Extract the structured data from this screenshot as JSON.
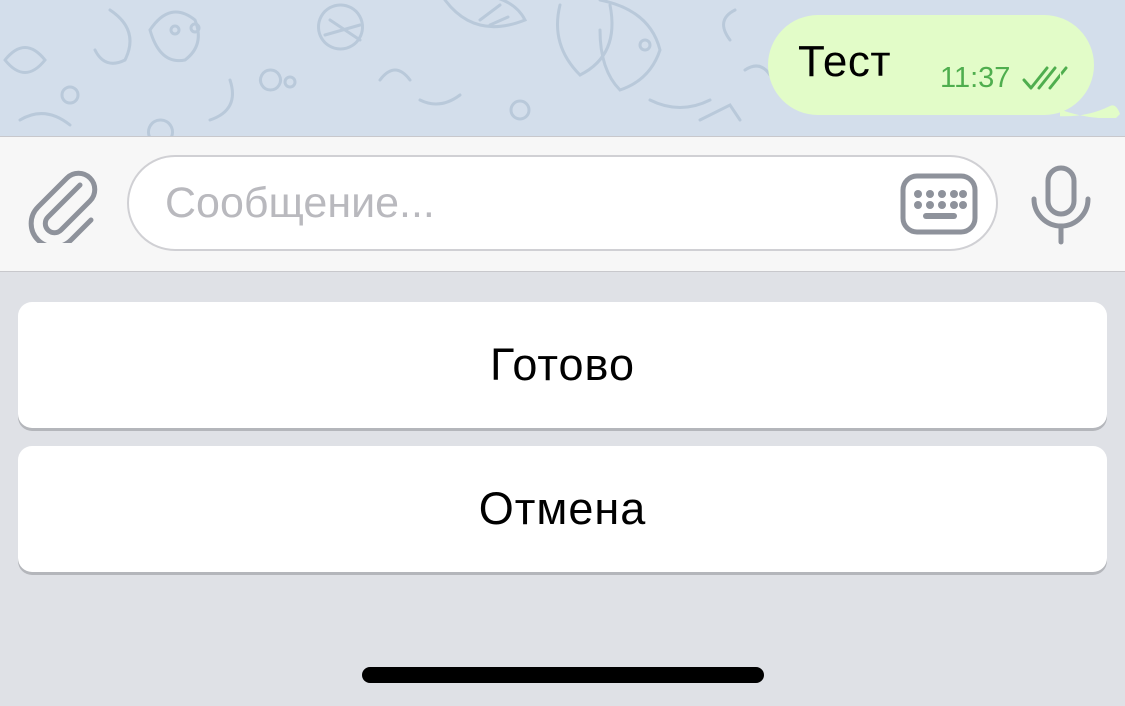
{
  "chat": {
    "outgoing_message": {
      "text": "Тест",
      "time": "11:37",
      "status_icon": "double-check-icon"
    }
  },
  "composer": {
    "placeholder": "Сообщение...",
    "value": "",
    "attach_icon": "paperclip-icon",
    "keyboard_icon": "keyboard-icon",
    "mic_icon": "microphone-icon"
  },
  "reply_keyboard": {
    "buttons": [
      {
        "label": "Готово"
      },
      {
        "label": "Отмена"
      }
    ]
  },
  "colors": {
    "chat_background": "#d3deeb",
    "outgoing_bubble": "#e2fcc8",
    "time_green": "#4fae4e",
    "icon_gray": "#8e929b",
    "keyboard_background": "#dfe1e6"
  }
}
